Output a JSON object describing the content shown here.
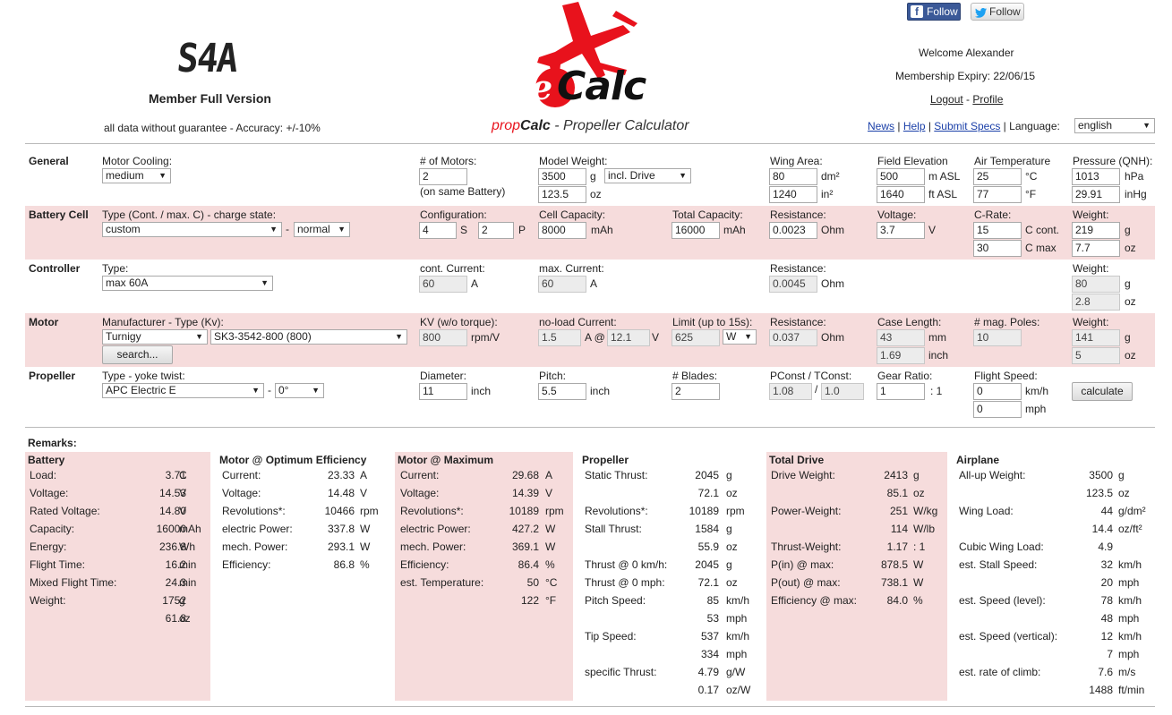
{
  "header": {
    "s4a_logo_text": "S4A",
    "member_text": "Member Full Version",
    "disclaimer": "all data without guarantee - Accuracy: +/-10%",
    "logo_e": "e",
    "logo_calc": "Calc",
    "subtitle_prop": "prop",
    "subtitle_calc": "Calc",
    "subtitle_rest": " - Propeller Calculator",
    "facebook_follow": "Follow",
    "twitter_follow": "Follow",
    "welcome": "Welcome Alexander",
    "membership": "Membership Expiry: 22/06/15",
    "logout": "Logout",
    "profile": "Profile",
    "news": "News",
    "help": "Help",
    "submit_specs": "Submit Specs",
    "language_label": "Language:",
    "language_value": "english",
    "colors": {
      "brand_red": "#e8121c",
      "band_pink": "#f6dcdc",
      "link_blue": "#1a3fa8",
      "facebook": "#3b5998",
      "twitter_blue": "#1da1f2"
    }
  },
  "general": {
    "title": "General",
    "motor_cooling_label": "Motor Cooling:",
    "motor_cooling": "medium",
    "num_motors_label": "# of Motors:",
    "num_motors": "2",
    "same_battery": "(on same Battery)",
    "model_weight_label": "Model Weight:",
    "model_weight_g": "3500",
    "unit_g": "g",
    "incl_drive": "incl. Drive",
    "model_weight_oz": "123.5",
    "unit_oz": "oz",
    "wing_area_label": "Wing Area:",
    "wing_area_dm2": "80",
    "unit_dm2": "dm²",
    "wing_area_in2": "1240",
    "unit_in2": "in²",
    "field_elev_label": "Field Elevation",
    "field_elev_m": "500",
    "unit_m_asl": "m ASL",
    "field_elev_ft": "1640",
    "unit_ft_asl": "ft ASL",
    "air_temp_label": "Air Temperature",
    "air_temp_c": "25",
    "unit_c": "°C",
    "air_temp_f": "77",
    "unit_f": "°F",
    "pressure_label": "Pressure (QNH):",
    "pressure_hpa": "1013",
    "unit_hpa": "hPa",
    "pressure_inhg": "29.91",
    "unit_inhg": "inHg"
  },
  "battery_cell": {
    "title": "Battery Cell",
    "type_label": "Type (Cont. / max. C) - charge state:",
    "type": "custom",
    "dash": "-",
    "charge_state": "normal",
    "config_label": "Configuration:",
    "s": "4",
    "unit_s": "S",
    "p": "2",
    "unit_p": "P",
    "cell_cap_label": "Cell Capacity:",
    "cell_cap": "8000",
    "unit_mah": "mAh",
    "total_cap_label": "Total Capacity:",
    "total_cap": "16000",
    "unit_mah2": "mAh",
    "resistance_label": "Resistance:",
    "resistance": "0.0023",
    "unit_ohm": "Ohm",
    "voltage_label": "Voltage:",
    "voltage": "3.7",
    "unit_v": "V",
    "crate_label": "C-Rate:",
    "c_cont": "15",
    "unit_c_cont": "C cont.",
    "c_max": "30",
    "unit_c_max": "C max",
    "weight_label": "Weight:",
    "weight_g": "219",
    "unit_g": "g",
    "weight_oz": "7.7",
    "unit_oz": "oz"
  },
  "controller": {
    "title": "Controller",
    "type_label": "Type:",
    "type": "max 60A",
    "cont_current_label": "cont. Current:",
    "cont_current": "60",
    "unit_a": "A",
    "max_current_label": "max. Current:",
    "max_current": "60",
    "unit_a2": "A",
    "resistance_label": "Resistance:",
    "resistance": "0.0045",
    "unit_ohm": "Ohm",
    "weight_label": "Weight:",
    "weight_g": "80",
    "unit_g": "g",
    "weight_oz": "2.8",
    "unit_oz": "oz"
  },
  "motor": {
    "title": "Motor",
    "manufacturer_label": "Manufacturer - Type (Kv):",
    "manufacturer": "Turnigy",
    "type": "SK3-3542-800 (800)",
    "search": "search...",
    "kv_label": "KV (w/o torque):",
    "kv": "800",
    "unit_kv": "rpm/V",
    "noload_label": "no-load Current:",
    "noload_current": "1.5",
    "unit_a_at": "A @",
    "noload_voltage": "12.1",
    "unit_v": "V",
    "limit_label": "Limit (up to 15s):",
    "limit": "625",
    "limit_unit": "W",
    "resistance_label": "Resistance:",
    "resistance": "0.037",
    "unit_ohm": "Ohm",
    "case_length_label": "Case Length:",
    "case_length_mm": "43",
    "unit_mm": "mm",
    "case_length_inch": "1.69",
    "unit_inch": "inch",
    "poles_label": "# mag. Poles:",
    "poles": "10",
    "weight_label": "Weight:",
    "weight_g": "141",
    "unit_g": "g",
    "weight_oz": "5",
    "unit_oz": "oz"
  },
  "propeller": {
    "title": "Propeller",
    "type_label": "Type - yoke twist:",
    "type": "APC Electric E",
    "dash": "-",
    "twist": "0°",
    "diameter_label": "Diameter:",
    "diameter": "11",
    "unit_inch": "inch",
    "pitch_label": "Pitch:",
    "pitch": "5.5",
    "unit_inch2": "inch",
    "blades_label": "# Blades:",
    "blades": "2",
    "pconst_label": "PConst / TConst:",
    "pconst": "1.08",
    "slash": "/",
    "tconst": "1.0",
    "gear_label": "Gear Ratio:",
    "gear": "1",
    "gear_suffix": ": 1",
    "flight_speed_label": "Flight Speed:",
    "speed_kmh": "0",
    "unit_kmh": "km/h",
    "speed_mph": "0",
    "unit_mph": "mph",
    "calculate": "calculate"
  },
  "remarks": {
    "title": "Remarks:",
    "battery": {
      "title": "Battery",
      "rows": [
        {
          "label": "Load:",
          "value": "3.71",
          "unit": "C"
        },
        {
          "label": "Voltage:",
          "value": "14.53",
          "unit": "V"
        },
        {
          "label": "Rated Voltage:",
          "value": "14.80",
          "unit": "V"
        },
        {
          "label": "Capacity:",
          "value": "16000",
          "unit": "mAh"
        },
        {
          "label": "Energy:",
          "value": "236.8",
          "unit": "Wh"
        },
        {
          "label": "Flight Time:",
          "value": "16.2",
          "unit": "min"
        },
        {
          "label": "Mixed Flight Time:",
          "value": "24.3",
          "unit": "min"
        },
        {
          "label": "Weight:",
          "value": "1752",
          "unit": "g"
        },
        {
          "label": "",
          "value": "61.8",
          "unit": "oz"
        }
      ]
    },
    "opt_eff": {
      "title": "Motor @ Optimum Efficiency",
      "rows": [
        {
          "label": "Current:",
          "value": "23.33",
          "unit": "A"
        },
        {
          "label": "Voltage:",
          "value": "14.48",
          "unit": "V"
        },
        {
          "label": "Revolutions*:",
          "value": "10466",
          "unit": "rpm"
        },
        {
          "label": "electric Power:",
          "value": "337.8",
          "unit": "W"
        },
        {
          "label": "mech. Power:",
          "value": "293.1",
          "unit": "W"
        },
        {
          "label": "Efficiency:",
          "value": "86.8",
          "unit": "%"
        }
      ]
    },
    "maximum": {
      "title": "Motor @ Maximum",
      "rows": [
        {
          "label": "Current:",
          "value": "29.68",
          "unit": "A"
        },
        {
          "label": "Voltage:",
          "value": "14.39",
          "unit": "V"
        },
        {
          "label": "Revolutions*:",
          "value": "10189",
          "unit": "rpm"
        },
        {
          "label": "electric Power:",
          "value": "427.2",
          "unit": "W"
        },
        {
          "label": "mech. Power:",
          "value": "369.1",
          "unit": "W"
        },
        {
          "label": "Efficiency:",
          "value": "86.4",
          "unit": "%"
        },
        {
          "label": "est. Temperature:",
          "value": "50",
          "unit": "°C"
        },
        {
          "label": "",
          "value": "122",
          "unit": "°F"
        }
      ]
    },
    "propeller": {
      "title": "Propeller",
      "rows": [
        {
          "label": "Static Thrust:",
          "value": "2045",
          "unit": "g"
        },
        {
          "label": "",
          "value": "72.1",
          "unit": "oz"
        },
        {
          "label": "Revolutions*:",
          "value": "10189",
          "unit": "rpm"
        },
        {
          "label": "Stall Thrust:",
          "value": "1584",
          "unit": "g"
        },
        {
          "label": "",
          "value": "55.9",
          "unit": "oz"
        },
        {
          "label": "Thrust @ 0 km/h:",
          "value": "2045",
          "unit": "g"
        },
        {
          "label": "Thrust @ 0 mph:",
          "value": "72.1",
          "unit": "oz"
        },
        {
          "label": "Pitch Speed:",
          "value": "85",
          "unit": "km/h"
        },
        {
          "label": "",
          "value": "53",
          "unit": "mph"
        },
        {
          "label": "Tip Speed:",
          "value": "537",
          "unit": "km/h"
        },
        {
          "label": "",
          "value": "334",
          "unit": "mph"
        },
        {
          "label": "specific Thrust:",
          "value": "4.79",
          "unit": "g/W"
        },
        {
          "label": "",
          "value": "0.17",
          "unit": "oz/W"
        }
      ]
    },
    "total_drive": {
      "title": "Total Drive",
      "rows": [
        {
          "label": "Drive Weight:",
          "value": "2413",
          "unit": "g"
        },
        {
          "label": "",
          "value": "85.1",
          "unit": "oz"
        },
        {
          "label": "Power-Weight:",
          "value": "251",
          "unit": "W/kg"
        },
        {
          "label": "",
          "value": "114",
          "unit": "W/lb"
        },
        {
          "label": "Thrust-Weight:",
          "value": "1.17",
          "unit": ": 1"
        },
        {
          "label": "P(in) @ max:",
          "value": "878.5",
          "unit": "W"
        },
        {
          "label": "P(out) @ max:",
          "value": "738.1",
          "unit": "W"
        },
        {
          "label": "Efficiency @ max:",
          "value": "84.0",
          "unit": "%"
        }
      ]
    },
    "airplane": {
      "title": "Airplane",
      "rows": [
        {
          "label": "All-up Weight:",
          "value": "3500",
          "unit": "g"
        },
        {
          "label": "",
          "value": "123.5",
          "unit": "oz"
        },
        {
          "label": "Wing Load:",
          "value": "44",
          "unit": "g/dm²"
        },
        {
          "label": "",
          "value": "14.4",
          "unit": "oz/ft²"
        },
        {
          "label": "Cubic Wing Load:",
          "value": "4.9",
          "unit": ""
        },
        {
          "label": "est. Stall Speed:",
          "value": "32",
          "unit": "km/h"
        },
        {
          "label": "",
          "value": "20",
          "unit": "mph"
        },
        {
          "label": "est. Speed (level):",
          "value": "78",
          "unit": "km/h"
        },
        {
          "label": "",
          "value": "48",
          "unit": "mph"
        },
        {
          "label": "est. Speed (vertical):",
          "value": "12",
          "unit": "km/h"
        },
        {
          "label": "",
          "value": "7",
          "unit": "mph"
        },
        {
          "label": "est. rate of climb:",
          "value": "7.6",
          "unit": "m/s"
        },
        {
          "label": "",
          "value": "1488",
          "unit": "ft/min"
        }
      ]
    }
  }
}
